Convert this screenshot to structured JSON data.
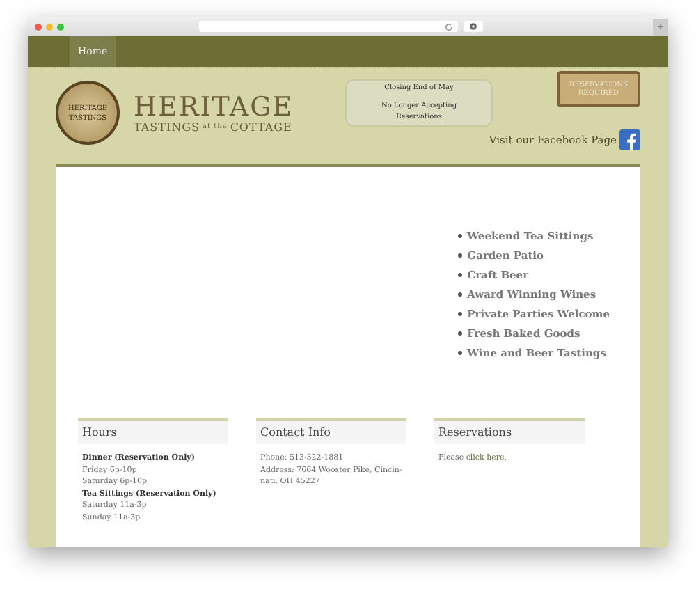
{
  "browser": {
    "new_tab": "+"
  },
  "nav": [
    {
      "label": "Home",
      "selected": true
    }
  ],
  "logo": {
    "seal_line_1": "HERITAGE",
    "seal_line_2": "TASTINGS",
    "title": "HERITAGE",
    "subtitle_left": "TASTINGS",
    "subtitle_mid": "at the",
    "subtitle_right": "COTTAGE"
  },
  "banner": {
    "top": "Closing End of May",
    "bottom": "No Longer Accepting Reservations"
  },
  "badge": "RESERVATIONS REQUIRED",
  "facebook_link": "Visit our Facebook Page",
  "features": [
    "Weekend Tea Sittings",
    "Garden Patio",
    "Craft Beer",
    "Award Winning Wines",
    "Private Parties Welcome",
    "Fresh Baked Goods",
    "Wine and Beer Tastings"
  ],
  "widgets": [
    {
      "title": "Hours",
      "lines": [
        {
          "kind": "heading",
          "text": "Dinner (Reservation Only)"
        },
        {
          "kind": "line",
          "text": "Friday 6p-10p"
        },
        {
          "kind": "line",
          "text": "Saturday 6p-10p"
        },
        {
          "kind": "heading",
          "text": "Tea Sittings (Reservation Only)"
        },
        {
          "kind": "line",
          "text": "Saturday 11a-3p"
        },
        {
          "kind": "line",
          "text": "Sunday 11a-3p"
        }
      ]
    },
    {
      "title": "Contact Info",
      "lines": [
        {
          "kind": "line",
          "text": "Phone: 513-322-1881"
        },
        {
          "kind": "line",
          "text": "Address: 7664 Wooster Pike, Cincin-nati, OH 45227"
        }
      ]
    },
    {
      "title": "Reservations",
      "lines": [
        {
          "kind": "link",
          "prefix": "Please",
          "text": "click here."
        }
      ]
    }
  ]
}
